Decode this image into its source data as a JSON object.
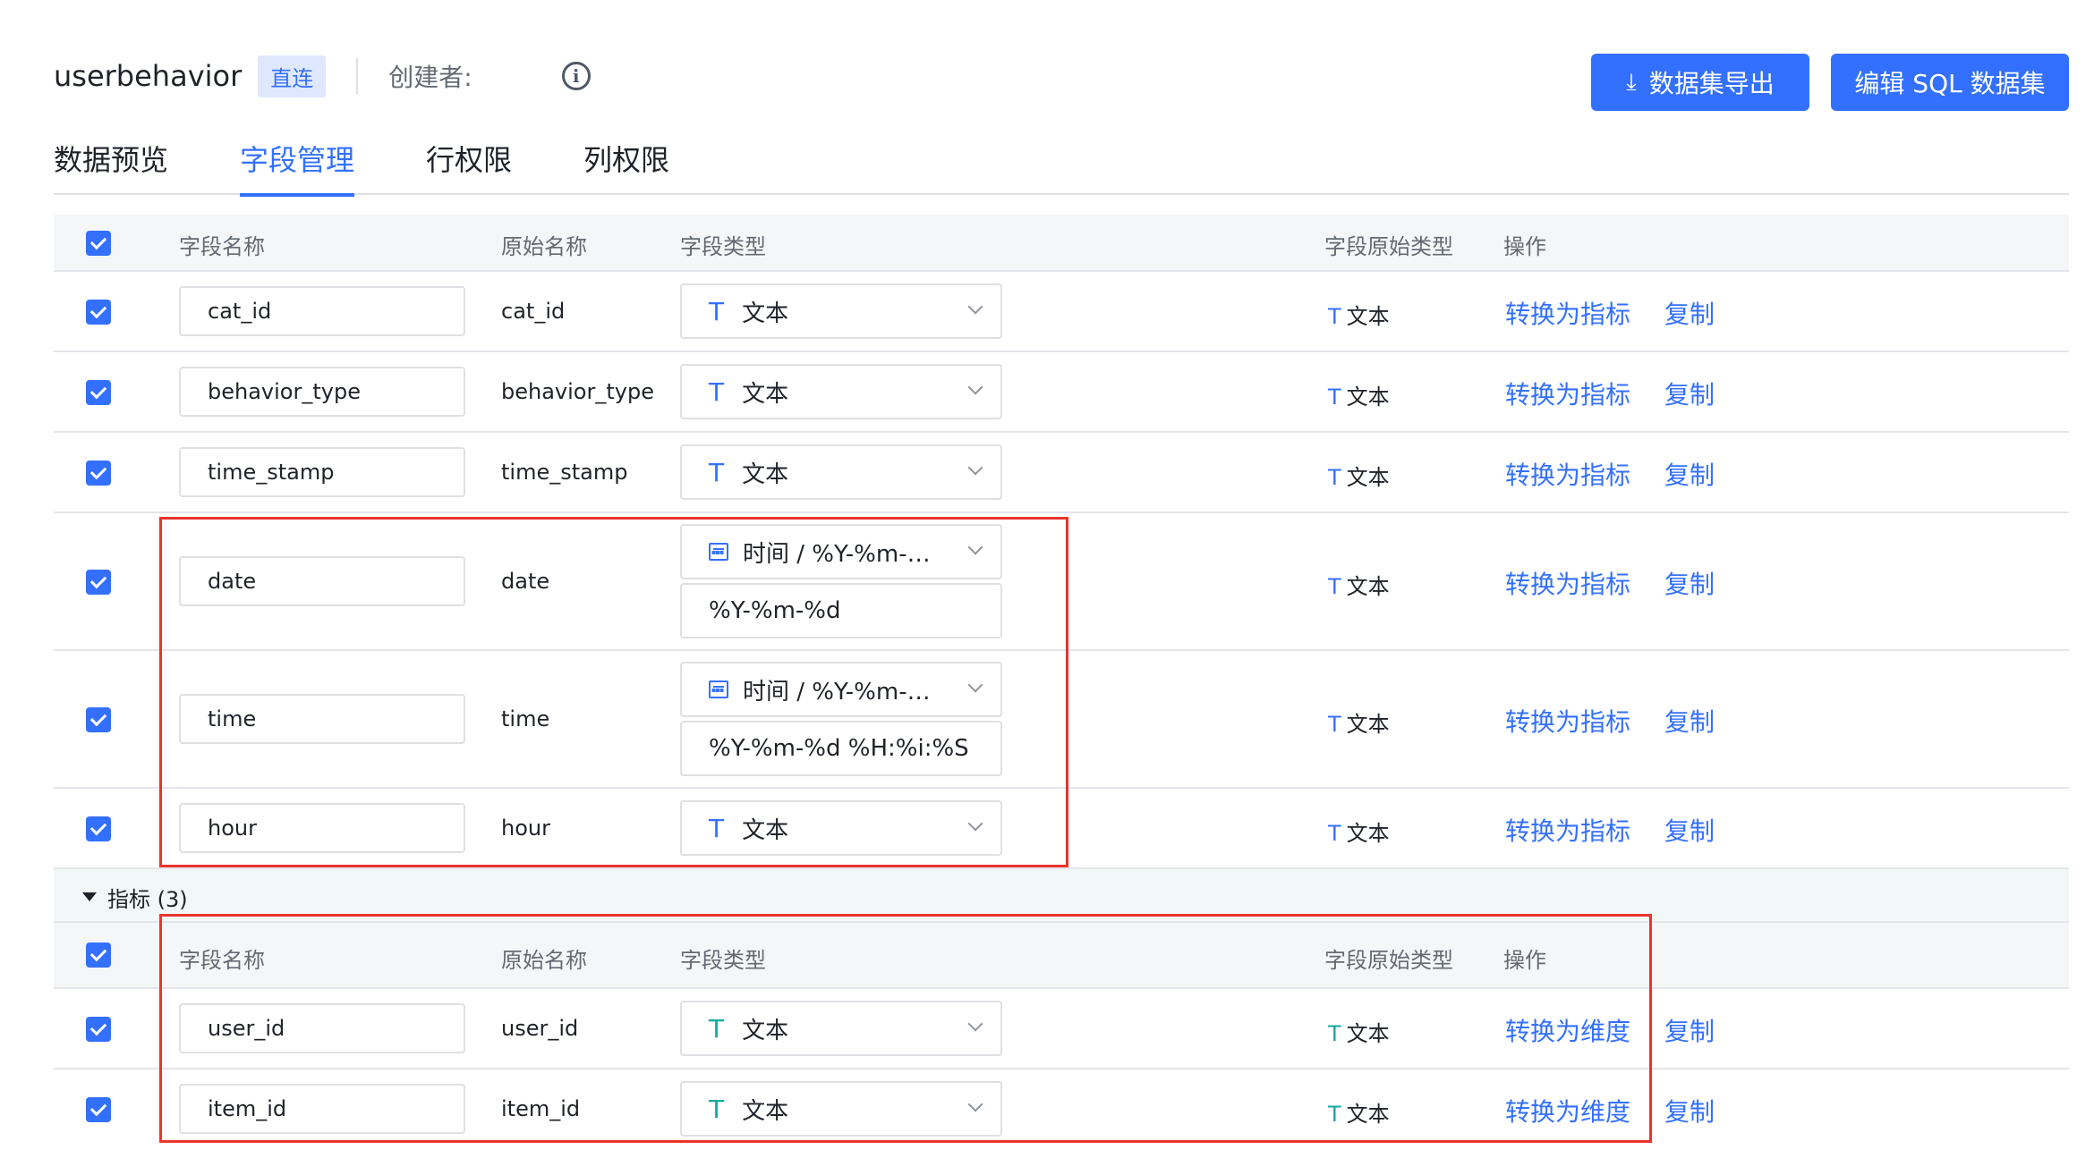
{
  "dataset": {
    "title": "userbehavior",
    "badge": "直连",
    "creator_label": "创建者:"
  },
  "buttons": {
    "export": "数据集导出",
    "edit_sql": "编辑 SQL 数据集"
  },
  "tabs": [
    {
      "label": "数据预览",
      "active": false
    },
    {
      "label": "字段管理",
      "active": true
    },
    {
      "label": "行权限",
      "active": false
    },
    {
      "label": "列权限",
      "active": false
    }
  ],
  "columns": {
    "field_name": "字段名称",
    "original_name": "原始名称",
    "field_type": "字段类型",
    "raw_type": "字段原始类型",
    "actions": "操作"
  },
  "dimension_rows": [
    {
      "name": "cat_id",
      "original": "cat_id",
      "type": "文本",
      "type_icon": "text-type-icon",
      "raw_type": "文本",
      "convert": "转换为指标",
      "copy": "复制"
    },
    {
      "name": "behavior_type",
      "original": "behavior_type",
      "type": "文本",
      "type_icon": "text-type-icon",
      "raw_type": "文本",
      "convert": "转换为指标",
      "copy": "复制"
    },
    {
      "name": "time_stamp",
      "original": "time_stamp",
      "type": "文本",
      "type_icon": "text-type-icon",
      "raw_type": "文本",
      "convert": "转换为指标",
      "copy": "复制"
    },
    {
      "name": "date",
      "original": "date",
      "type": "时间 / %Y-%m-…",
      "type_icon": "calendar-icon",
      "format": "%Y-%m-%d",
      "raw_type": "文本",
      "convert": "转换为指标",
      "copy": "复制"
    },
    {
      "name": "time",
      "original": "time",
      "type": "时间 / %Y-%m-…",
      "type_icon": "calendar-icon",
      "format": "%Y-%m-%d %H:%i:%S",
      "raw_type": "文本",
      "convert": "转换为指标",
      "copy": "复制"
    },
    {
      "name": "hour",
      "original": "hour",
      "type": "文本",
      "type_icon": "text-type-icon",
      "raw_type": "文本",
      "convert": "转换为指标",
      "copy": "复制"
    }
  ],
  "metric_group": {
    "title": "指标 (3)"
  },
  "metric_rows": [
    {
      "name": "user_id",
      "original": "user_id",
      "type": "文本",
      "type_icon": "text-type-icon",
      "raw_type": "文本",
      "convert": "转换为维度",
      "copy": "复制"
    },
    {
      "name": "item_id",
      "original": "item_id",
      "type": "文本",
      "type_icon": "text-type-icon",
      "raw_type": "文本",
      "convert": "转换为维度",
      "copy": "复制"
    }
  ],
  "colors": {
    "accent": "#3370ff",
    "highlight_box": "#e8352e",
    "metric_icon": "#14a9a0"
  }
}
